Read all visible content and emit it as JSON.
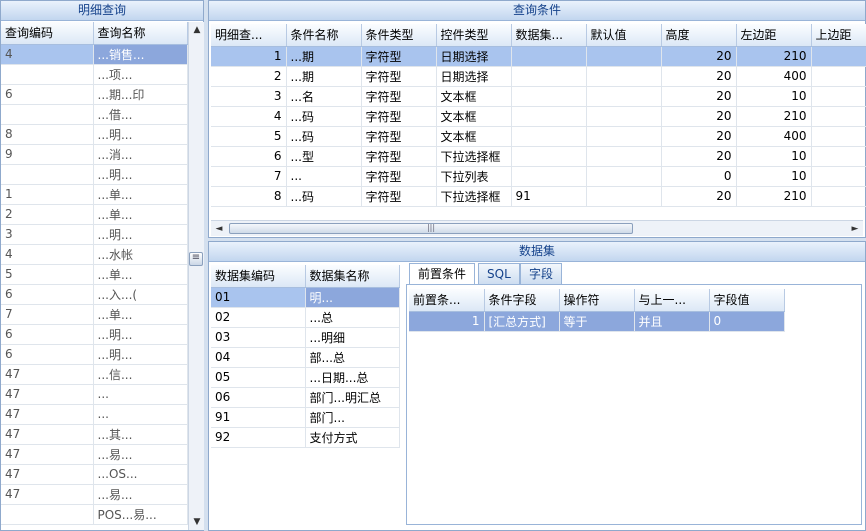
{
  "left_panel": {
    "title": "明细查询",
    "columns": [
      "查询编码",
      "查询名称"
    ],
    "rows": [
      {
        "code": "4",
        "name": "...销售..."
      },
      {
        "code": "",
        "name": "...项..."
      },
      {
        "code": "6",
        "name": "...期...印"
      },
      {
        "code": "",
        "name": "...借..."
      },
      {
        "code": "8",
        "name": "...明..."
      },
      {
        "code": "9",
        "name": "...消..."
      },
      {
        "code": "",
        "name": "...明..."
      },
      {
        "code": "1",
        "name": "...单..."
      },
      {
        "code": "2",
        "name": "...单..."
      },
      {
        "code": "3",
        "name": "...明..."
      },
      {
        "code": "4",
        "name": "...水帐"
      },
      {
        "code": "5",
        "name": "...单..."
      },
      {
        "code": "6",
        "name": "...入...("
      },
      {
        "code": "7",
        "name": "...单..."
      },
      {
        "code": "6",
        "name": "...明..."
      },
      {
        "code": "6",
        "name": "...明..."
      },
      {
        "code": "47",
        "name": "...信..."
      },
      {
        "code": "47",
        "name": "..."
      },
      {
        "code": "47",
        "name": "..."
      },
      {
        "code": "47",
        "name": "...其..."
      },
      {
        "code": "47",
        "name": "...易..."
      },
      {
        "code": "47",
        "name": "...OS..."
      },
      {
        "code": "47",
        "name": "...易..."
      },
      {
        "code": "",
        "name": "POS...易..."
      }
    ]
  },
  "query_panel": {
    "title": "查询条件",
    "columns": [
      "明细查...",
      "条件名称",
      "条件类型",
      "控件类型",
      "数据集...",
      "默认值",
      "高度",
      "左边距",
      "上边距"
    ],
    "rows": [
      {
        "idx": "1",
        "name": "...期",
        "ctype": "字符型",
        "widget": "日期选择",
        "dataset": "",
        "default": "",
        "height": "20",
        "left": "210"
      },
      {
        "idx": "2",
        "name": "...期",
        "ctype": "字符型",
        "widget": "日期选择",
        "dataset": "",
        "default": "",
        "height": "20",
        "left": "400"
      },
      {
        "idx": "3",
        "name": "...名",
        "ctype": "字符型",
        "widget": "文本框",
        "dataset": "",
        "default": "",
        "height": "20",
        "left": "10"
      },
      {
        "idx": "4",
        "name": "...码",
        "ctype": "字符型",
        "widget": "文本框",
        "dataset": "",
        "default": "",
        "height": "20",
        "left": "210"
      },
      {
        "idx": "5",
        "name": "...码",
        "ctype": "字符型",
        "widget": "文本框",
        "dataset": "",
        "default": "",
        "height": "20",
        "left": "400"
      },
      {
        "idx": "6",
        "name": "...型",
        "ctype": "字符型",
        "widget": "下拉选择框",
        "dataset": "",
        "default": "",
        "height": "20",
        "left": "10"
      },
      {
        "idx": "7",
        "name": "...",
        "ctype": "字符型",
        "widget": "下拉列表",
        "dataset": "",
        "default": "",
        "height": "0",
        "left": "10"
      },
      {
        "idx": "8",
        "name": "...码",
        "ctype": "字符型",
        "widget": "下拉选择框",
        "dataset": "91",
        "default": "",
        "height": "20",
        "left": "210"
      }
    ]
  },
  "dataset_panel": {
    "title": "数据集",
    "columns": [
      "数据集编码",
      "数据集名称"
    ],
    "rows": [
      {
        "code": "01",
        "name": "明..."
      },
      {
        "code": "02",
        "name": "...总"
      },
      {
        "code": "03",
        "name": "...明细"
      },
      {
        "code": "04",
        "name": "部...总"
      },
      {
        "code": "05",
        "name": "...日期...总"
      },
      {
        "code": "06",
        "name": "部门...明汇总"
      },
      {
        "code": "91",
        "name": "部门..."
      },
      {
        "code": "92",
        "name": "支付方式"
      }
    ]
  },
  "tabs": [
    "前置条件",
    "SQL",
    "字段"
  ],
  "precondition": {
    "columns": [
      "前置条...",
      "条件字段",
      "操作符",
      "与上一...",
      "字段值"
    ],
    "rows": [
      {
        "idx": "1",
        "field": "[汇总方式]",
        "op": "等于",
        "link": "并且",
        "value": "0"
      }
    ]
  },
  "scroll": {
    "up": "▲",
    "down": "▼",
    "left": "◄",
    "right": "►",
    "grip": "≡",
    "hgrip": "|||"
  },
  "colors": {
    "title_text": "#15428b",
    "selection": "#a9c4ee",
    "selection_cell": "#8ca7dc"
  }
}
